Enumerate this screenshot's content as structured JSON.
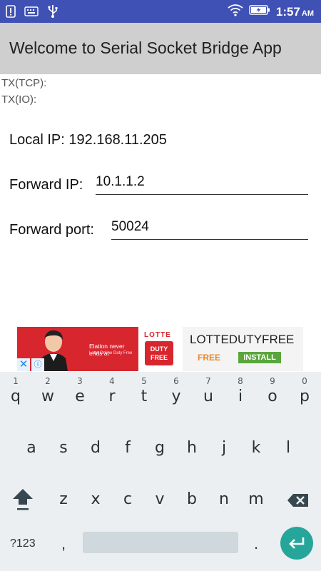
{
  "status_bar": {
    "time": "1:57",
    "ampm": "AM",
    "left_icons": [
      "alert-icon",
      "keyboard-icon",
      "usb-icon"
    ],
    "right_icons": [
      "wifi-icon",
      "battery-charging-icon"
    ],
    "bg_color": "#3f51b5"
  },
  "app_bar": {
    "title": "Welcome to Serial Socket Bridge App",
    "bg_color": "#cfcfcf"
  },
  "tx": {
    "tcp_label": "TX(TCP):",
    "io_label": "TX(IO):"
  },
  "form": {
    "local_ip_label": "Local IP:",
    "local_ip_value": "192.168.11.205",
    "forward_ip_label": "Forward IP:",
    "forward_ip_value": "10.1.1.2",
    "forward_port_label": "Forward port:",
    "forward_port_value": "50024"
  },
  "ad": {
    "tagline": "Elation never ends at",
    "subline": "Lotte Online Duty Free",
    "logo_top": "LOTTE",
    "logo_box_line1": "DUTY",
    "logo_box_line2": "FREE",
    "brand": "LOTTEDUTYFREE",
    "price": "FREE",
    "install_label": "INSTALL",
    "close_icon": "close-icon",
    "info_icon": "info-icon",
    "accent_color": "#d8262f"
  },
  "keyboard": {
    "row1": [
      {
        "char": "q",
        "hint": "1"
      },
      {
        "char": "w",
        "hint": "2"
      },
      {
        "char": "e",
        "hint": "3"
      },
      {
        "char": "r",
        "hint": "4"
      },
      {
        "char": "t",
        "hint": "5"
      },
      {
        "char": "y",
        "hint": "6"
      },
      {
        "char": "u",
        "hint": "7"
      },
      {
        "char": "i",
        "hint": "8"
      },
      {
        "char": "o",
        "hint": "9"
      },
      {
        "char": "p",
        "hint": "0"
      }
    ],
    "row2": [
      "a",
      "s",
      "d",
      "f",
      "g",
      "h",
      "j",
      "k",
      "l"
    ],
    "row3": [
      "z",
      "x",
      "c",
      "v",
      "b",
      "n",
      "m"
    ],
    "symbols_label": "?123",
    "comma": ",",
    "period": ".",
    "shift_icon": "shift-icon",
    "backspace_icon": "backspace-icon",
    "enter_icon": "enter-icon",
    "enter_color": "#26a69a"
  }
}
